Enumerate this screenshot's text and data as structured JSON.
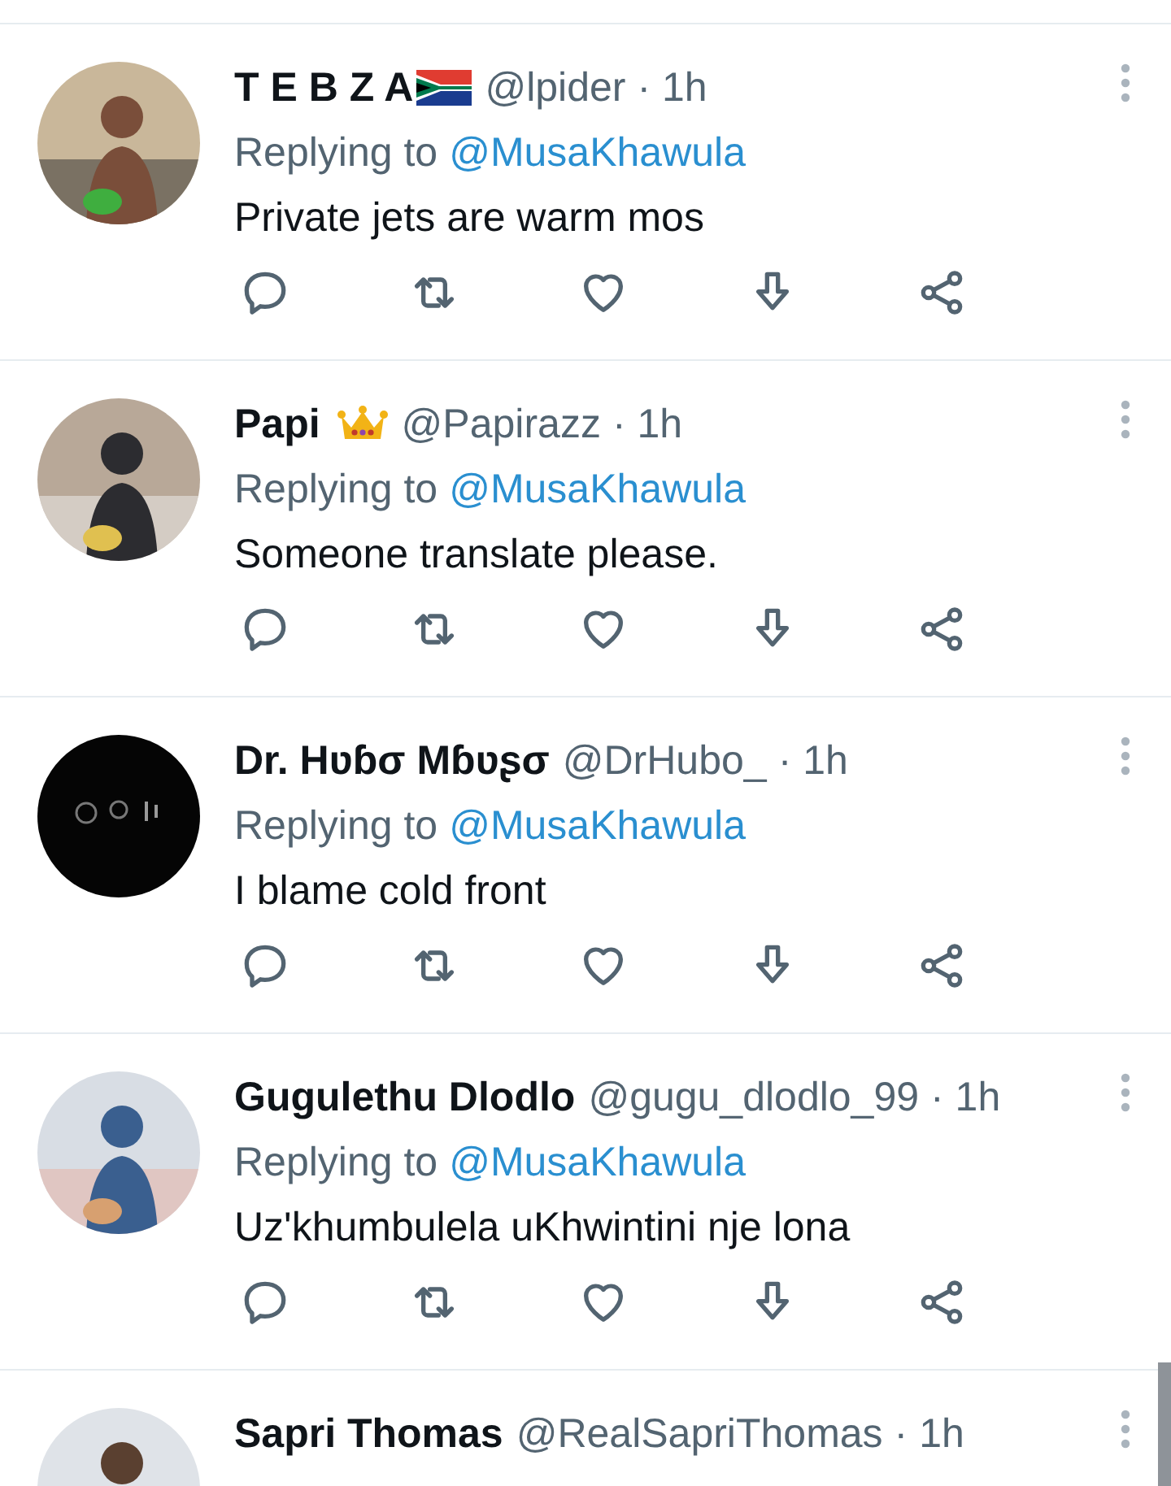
{
  "replies": [
    {
      "name": "T E B Z A",
      "name_icon": {
        "kind": "flag"
      },
      "handle": "@lpider",
      "time": "· 1h",
      "replying_prefix": "Replying to",
      "mention": "@MusaKhawula",
      "text": "Private jets are warm mos"
    },
    {
      "name": "Papi",
      "name_icon": {
        "kind": "crown"
      },
      "handle": "@Papirazz",
      "time": "· 1h",
      "replying_prefix": "Replying to",
      "mention": "@MusaKhawula",
      "text": "Someone translate please."
    },
    {
      "name": "Dr. Hʋɓσ Mɓʋʂσ",
      "handle": "@DrHubo_",
      "time": "· 1h",
      "replying_prefix": "Replying to",
      "mention": "@MusaKhawula",
      "text": "I blame cold front"
    },
    {
      "name": "Gugulethu Dlodlo",
      "handle": "@gugu_dlodlo_99",
      "time": "· 1h",
      "replying_prefix": "Replying to",
      "mention": "@MusaKhawula",
      "text": "Uz'khumbulela uKhwintini nje lona"
    },
    {
      "name": "Sapri Thomas",
      "handle": "@RealSapriThomas",
      "time": "· 1h"
    }
  ]
}
